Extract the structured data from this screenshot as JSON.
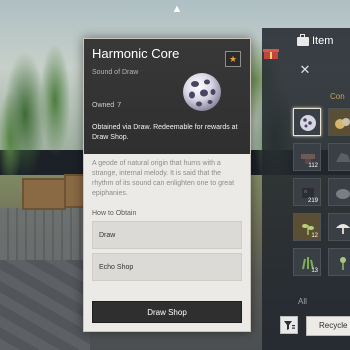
{
  "item_detail": {
    "name": "Harmonic Core",
    "subtitle": "Sound of Draw",
    "owned_label": "Owned",
    "owned_count": "7",
    "obtain_info": "Obtained via Draw. Redeemable for rewards at Draw Shop.",
    "lore": "A geode of natural origin that hums with a strange, internal melody. It is said that the rhythm of its sound can enlighten one to great epiphanies.",
    "how_to_obtain_label": "How to Obtain",
    "sources": [
      "Draw",
      "Echo Shop"
    ],
    "action_label": "Draw Shop",
    "favorite_icon": "star-icon"
  },
  "inventory": {
    "title": "Item",
    "category_label": "Con",
    "filter_label": "All",
    "recycle_label": "Recycle",
    "slots": [
      {
        "count": "",
        "selected": true,
        "icon": "harmonic-core-icon"
      },
      {
        "count": "",
        "selected": false,
        "icon": "gold-ore-icon"
      },
      {
        "count": "112",
        "selected": false,
        "icon": "anvil-icon"
      },
      {
        "count": "",
        "selected": false,
        "icon": "dark-ore-icon"
      },
      {
        "count": "219",
        "selected": false,
        "icon": "dark-cube-icon"
      },
      {
        "count": "",
        "selected": false,
        "icon": "stone-icon"
      },
      {
        "count": "12",
        "selected": false,
        "icon": "herb-icon"
      },
      {
        "count": "",
        "selected": false,
        "icon": "mushroom-icon"
      },
      {
        "count": "13",
        "selected": false,
        "icon": "grass-icon"
      },
      {
        "count": "",
        "selected": false,
        "icon": "plant-icon"
      }
    ]
  },
  "colors": {
    "card_header": "#2f2f2f",
    "card_body": "#eceae6",
    "panel_bg": "#22272d",
    "accent_gold": "#c6a25a"
  }
}
